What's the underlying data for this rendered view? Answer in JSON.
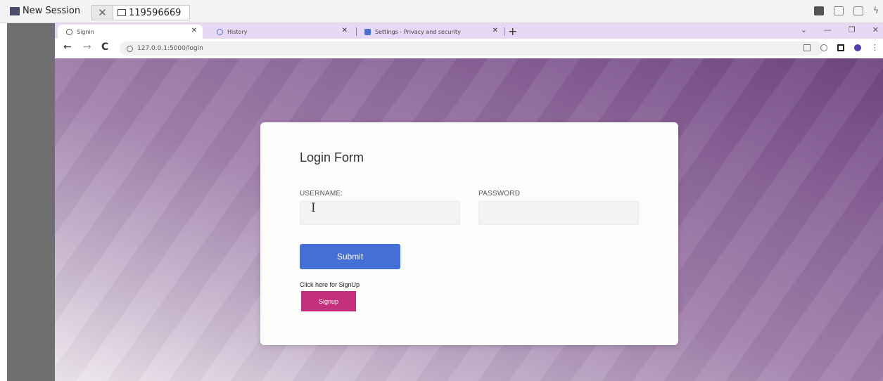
{
  "session": {
    "label": "New Session",
    "session_id": "119596669"
  },
  "browser": {
    "tabs": [
      {
        "label": "Signin",
        "active": true
      },
      {
        "label": "History",
        "active": false
      },
      {
        "label": "Settings - Privacy and security",
        "active": false
      }
    ],
    "url": "127.0.0.1:5000/login"
  },
  "form": {
    "title": "Login Form",
    "username_label": "USERNAME:",
    "password_label": "PASSWORD",
    "username_value": "",
    "password_value": "",
    "submit_label": "Submit",
    "signup_prompt": "Click here for SignUp",
    "signup_label": "Signup"
  },
  "colors": {
    "submit": "#4470d6",
    "signup": "#c2307e",
    "chrome_tabbar": "#e9d8f4"
  }
}
